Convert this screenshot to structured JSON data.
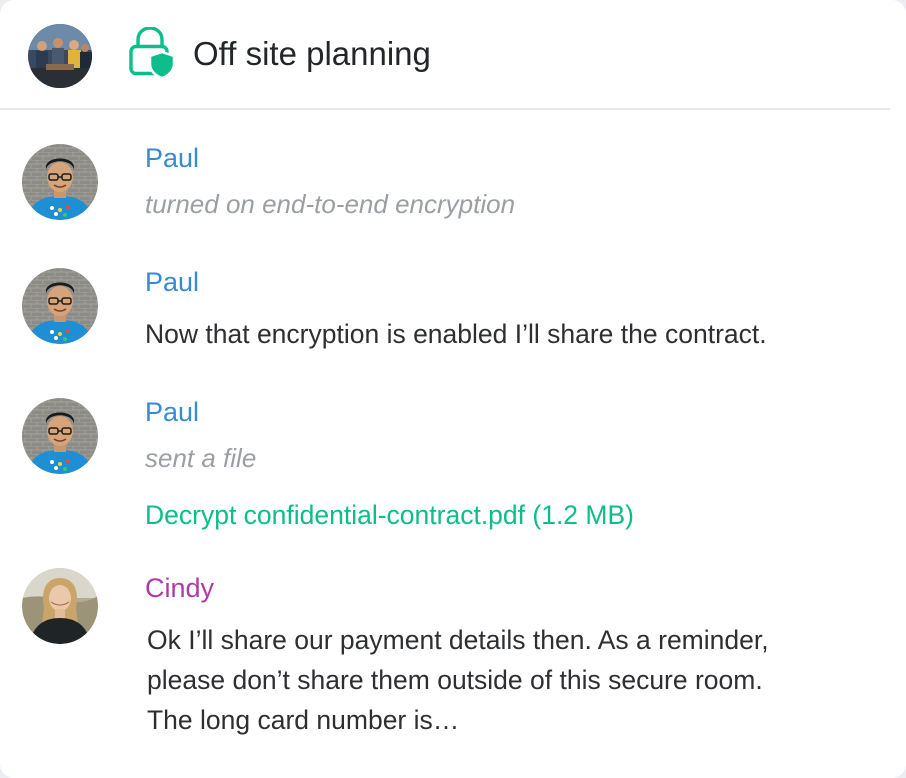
{
  "room": {
    "title": "Off site planning",
    "avatar_icon": "room-group-photo",
    "encryption_icon": "lock-shield-icon",
    "accent_color": "#0dbd8b"
  },
  "colors": {
    "paul": "#368bd6",
    "cindy": "#ac3ba8",
    "notice": "#9b9fa3",
    "link": "#0dbd8b"
  },
  "messages": [
    {
      "sender": "Paul",
      "notice": "turned on end-to-end encryption"
    },
    {
      "sender": "Paul",
      "text": "Now that encryption is enabled I’ll share the contract."
    },
    {
      "sender": "Paul",
      "notice": "sent a file",
      "file_link": "Decrypt confidential-contract.pdf (1.2 MB)"
    },
    {
      "sender": "Cindy",
      "lines": [
        "Ok I’ll share our payment details then. As a reminder,",
        "please don’t share them outside of this secure room.",
        "The long card number is…"
      ]
    }
  ]
}
